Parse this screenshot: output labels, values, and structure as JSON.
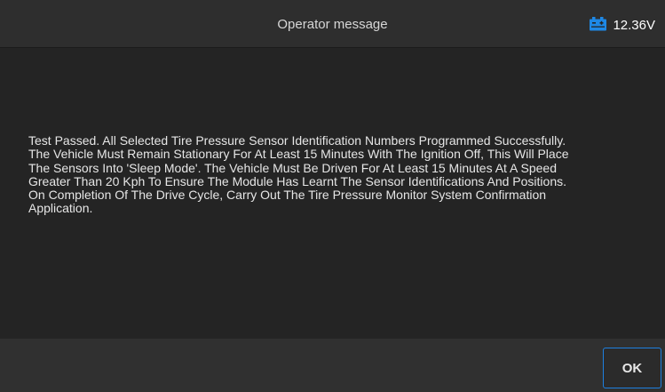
{
  "header": {
    "title": "Operator message",
    "battery_icon": "vehicle-battery-icon",
    "voltage": "12.36V"
  },
  "message": {
    "text": "Test Passed. All Selected Tire Pressure Sensor Identification Numbers Programmed Successfully.\nThe Vehicle Must Remain Stationary For At Least 15 Minutes With The Ignition Off, This Will Place\nThe Sensors Into 'Sleep Mode'. The Vehicle Must Be Driven For At Least 15 Minutes At A Speed\nGreater Than 20 Kph To Ensure The Module Has Learnt The Sensor Identifications And Positions.\nOn Completion Of The Drive Cycle, Carry Out The Tire Pressure Monitor System Confirmation\nApplication."
  },
  "footer": {
    "ok_label": "OK"
  },
  "colors": {
    "accent": "#1e80e0",
    "battery_icon": "#1e88e5",
    "background": "#242424",
    "header_background": "#2e2e2e",
    "footer_background": "#303030"
  }
}
